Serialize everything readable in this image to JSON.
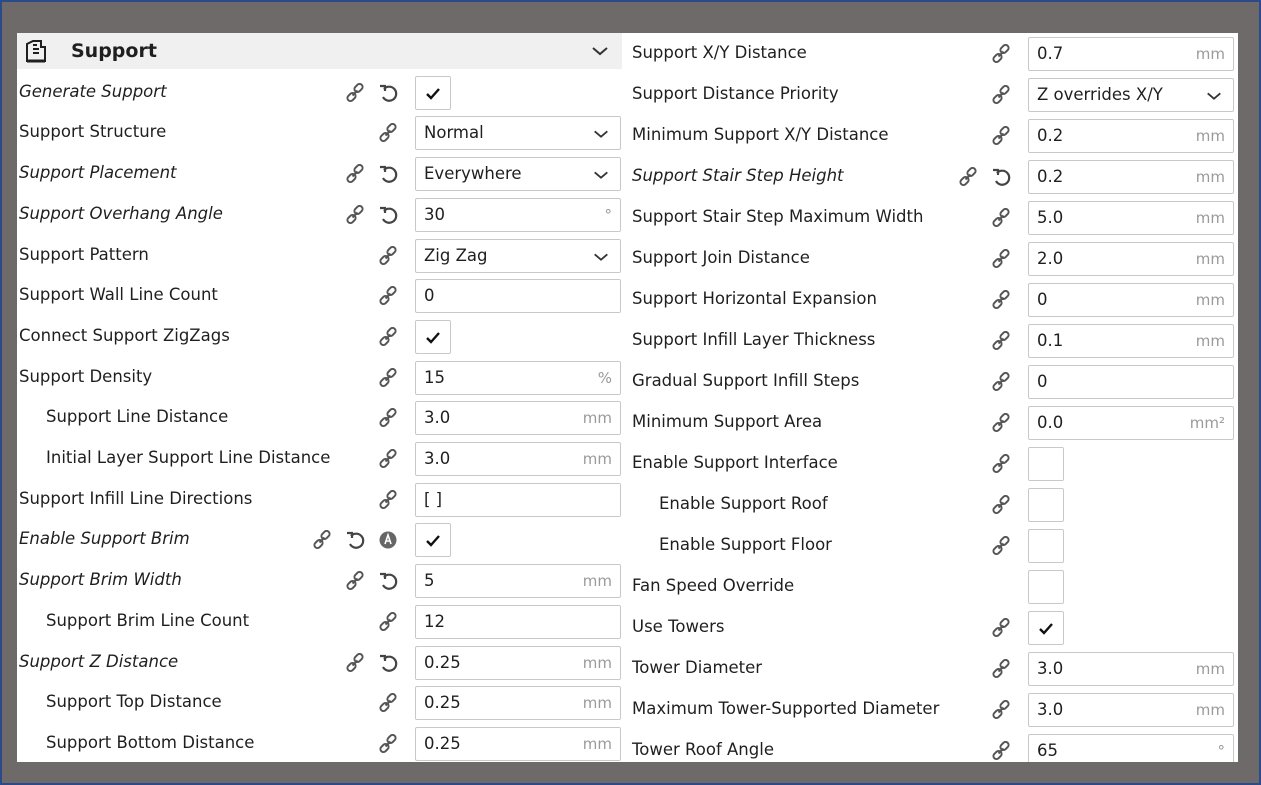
{
  "section": {
    "title": "Support"
  },
  "left": [
    {
      "label": "Generate Support",
      "italic": true,
      "reset": true,
      "type": "check",
      "checked": true
    },
    {
      "label": "Support Structure",
      "type": "select",
      "value": "Normal"
    },
    {
      "label": "Support Placement",
      "italic": true,
      "reset": true,
      "type": "select",
      "value": "Everywhere"
    },
    {
      "label": "Support Overhang Angle",
      "italic": true,
      "reset": true,
      "type": "input",
      "value": "30",
      "unit": "°"
    },
    {
      "label": "Support Pattern",
      "type": "select",
      "value": "Zig Zag"
    },
    {
      "label": "Support Wall Line Count",
      "type": "input",
      "value": "0",
      "unit": ""
    },
    {
      "label": "Connect Support ZigZags",
      "type": "check",
      "checked": true
    },
    {
      "label": "Support Density",
      "type": "input",
      "value": "15",
      "unit": "%"
    },
    {
      "label": "Support Line Distance",
      "indent": true,
      "type": "input",
      "value": "3.0",
      "unit": "mm"
    },
    {
      "label": "Initial Layer Support Line Distance",
      "indent": true,
      "type": "input",
      "value": "3.0",
      "unit": "mm"
    },
    {
      "label": "Support Infill Line Directions",
      "type": "input",
      "value": "[ ]",
      "unit": ""
    },
    {
      "label": "Enable Support Brim",
      "italic": true,
      "reset": true,
      "info": true,
      "type": "check",
      "checked": true
    },
    {
      "label": "Support Brim Width",
      "italic": true,
      "reset": true,
      "type": "input",
      "value": "5",
      "unit": "mm"
    },
    {
      "label": "Support Brim Line Count",
      "indent": true,
      "type": "input",
      "value": "12",
      "unit": ""
    },
    {
      "label": "Support Z Distance",
      "italic": true,
      "reset": true,
      "type": "input",
      "value": "0.25",
      "unit": "mm"
    },
    {
      "label": "Support Top Distance",
      "indent": true,
      "type": "input",
      "value": "0.25",
      "unit": "mm"
    },
    {
      "label": "Support Bottom Distance",
      "indent": true,
      "type": "input",
      "value": "0.25",
      "unit": "mm"
    }
  ],
  "right": [
    {
      "label": "Support X/Y Distance",
      "type": "input",
      "value": "0.7",
      "unit": "mm"
    },
    {
      "label": "Support Distance Priority",
      "type": "select",
      "value": "Z overrides X/Y"
    },
    {
      "label": "Minimum Support X/Y Distance",
      "type": "input",
      "value": "0.2",
      "unit": "mm"
    },
    {
      "label": "Support Stair Step Height",
      "italic": true,
      "reset": true,
      "type": "input",
      "value": "0.2",
      "unit": "mm"
    },
    {
      "label": "Support Stair Step Maximum Width",
      "type": "input",
      "value": "5.0",
      "unit": "mm"
    },
    {
      "label": "Support Join Distance",
      "type": "input",
      "value": "2.0",
      "unit": "mm"
    },
    {
      "label": "Support Horizontal Expansion",
      "type": "input",
      "value": "0",
      "unit": "mm"
    },
    {
      "label": "Support Infill Layer Thickness",
      "type": "input",
      "value": "0.1",
      "unit": "mm"
    },
    {
      "label": "Gradual Support Infill Steps",
      "type": "input",
      "value": "0",
      "unit": ""
    },
    {
      "label": "Minimum Support Area",
      "type": "input",
      "value": "0.0",
      "unit": "mm²"
    },
    {
      "label": "Enable Support Interface",
      "type": "check",
      "checked": false
    },
    {
      "label": "Enable Support Roof",
      "indent": true,
      "type": "check",
      "checked": false
    },
    {
      "label": "Enable Support Floor",
      "indent": true,
      "type": "check",
      "checked": false
    },
    {
      "label": "Fan Speed Override",
      "nolink": true,
      "type": "check",
      "checked": false
    },
    {
      "label": "Use Towers",
      "type": "check",
      "checked": true
    },
    {
      "label": "Tower Diameter",
      "type": "input",
      "value": "3.0",
      "unit": "mm"
    },
    {
      "label": "Maximum Tower-Supported Diameter",
      "type": "input",
      "value": "3.0",
      "unit": "mm"
    },
    {
      "label": "Tower Roof Angle",
      "type": "input",
      "value": "65",
      "unit": "°"
    }
  ],
  "icons": {
    "section": "support-icon",
    "link": "link-icon",
    "reset": "reset-icon",
    "info": "inherit-info-icon",
    "dropdown": "chevron-down-icon",
    "check": "checkmark-icon"
  }
}
